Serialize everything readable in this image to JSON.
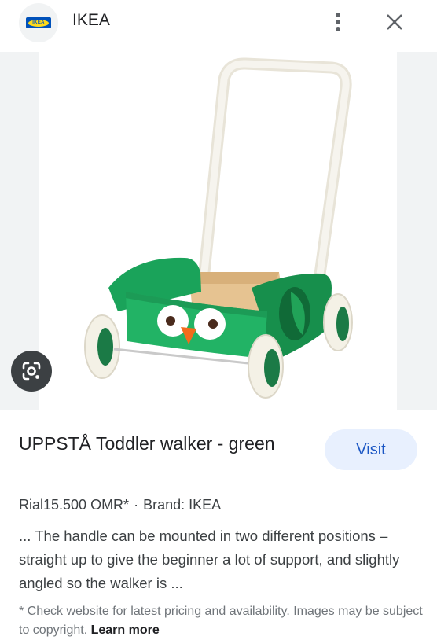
{
  "header": {
    "logo_text": "IKEA",
    "site_name": "IKEA",
    "more_icon": "more-vert-icon",
    "close_icon": "close-icon"
  },
  "image": {
    "subject": "toddler walker",
    "lens_icon": "google-lens-icon",
    "colors": {
      "body": "#1aa35a",
      "wheel": "#f4f1e6",
      "handle": "#f1eee6",
      "tray": "#e9c89b",
      "beak": "#f26b1d"
    }
  },
  "product": {
    "title": "UPPSTÅ Toddler walker - green",
    "visit_label": "Visit",
    "price": "Rial15.500 OMR*",
    "separator": "·",
    "brand": "Brand: IKEA",
    "description": "... The handle can be mounted in two different positions – straight up to give the beginner a lot of support, and slightly angled so the walker is ...",
    "disclaimer": "* Check website for latest pricing and availability. Images may be subject to copyright.",
    "learn_more": "Learn more"
  },
  "colors": {
    "accent": "#1a56c4",
    "visit_bg": "#e8f0fe",
    "text": "#202124",
    "secondary": "#3c4043"
  }
}
